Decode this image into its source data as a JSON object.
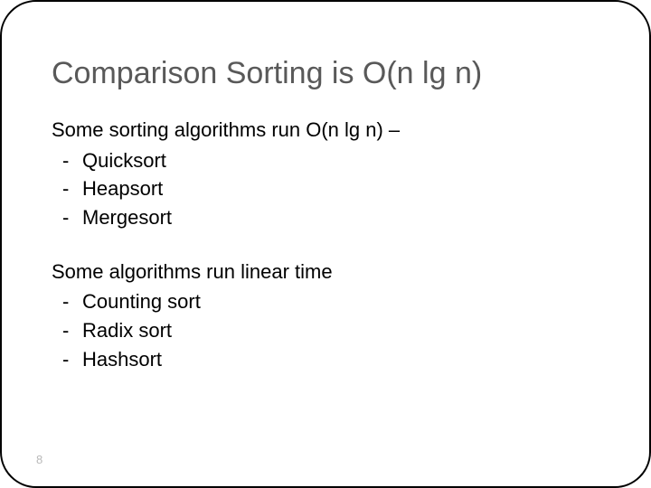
{
  "title": "Comparison Sorting is O(n lg n)",
  "section1": {
    "intro": "Some sorting algorithms run O(n lg n) –",
    "i0": "Quicksort",
    "i1": "Heapsort",
    "i2": "Mergesort"
  },
  "section2": {
    "intro": "Some algorithms run linear time",
    "i0": "Counting sort",
    "i1": "Radix sort",
    "i2": "Hashsort"
  },
  "pagenum": "8"
}
